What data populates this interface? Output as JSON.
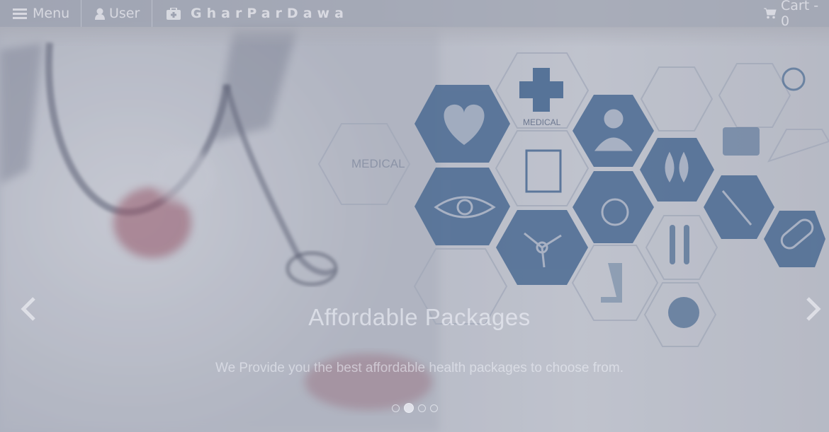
{
  "navbar": {
    "menu_label": "Menu",
    "user_label": "User",
    "brand_name": "GharParDawa",
    "cart_label": "Cart - 0"
  },
  "carousel": {
    "title": "Affordable Packages",
    "text": "We Provide you the best affordable health packages to choose from.",
    "prev_icon": "chevron-left-icon",
    "next_icon": "chevron-right-icon",
    "slide_count": 4,
    "active_index": 1,
    "hex_label_medical": "MEDICAL",
    "hex_label_medical_small": "MEDICAL"
  },
  "colors": {
    "hex_blue": "#3d6796",
    "hex_outline": "#b8bfcc",
    "overlay": "#6e748c"
  }
}
